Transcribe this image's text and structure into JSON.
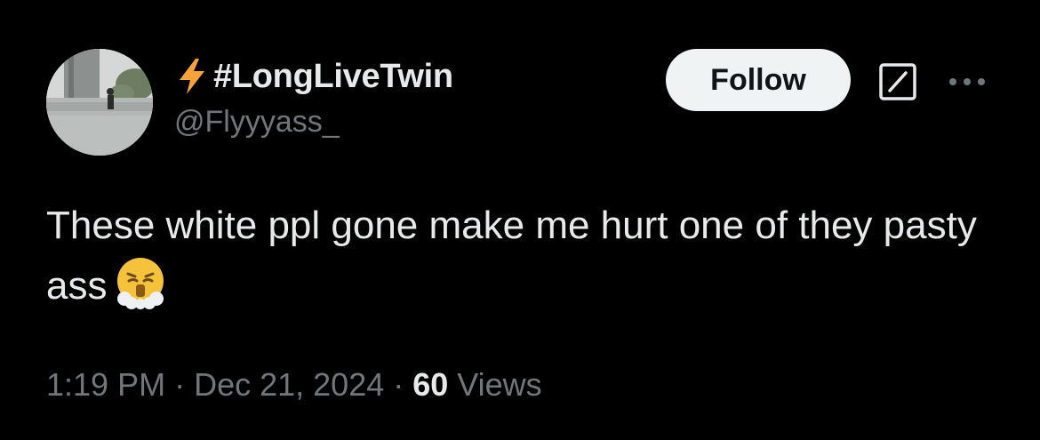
{
  "author": {
    "display_name": "#LongLiveTwin",
    "handle": "@Flyyyass_",
    "name_emoji_icon": "high-voltage-icon",
    "avatar_icon": "profile-photo-avatar"
  },
  "header": {
    "follow_label": "Follow",
    "grok_icon": "grok-icon",
    "more_icon": "more-options-icon"
  },
  "tweet": {
    "text": "These white ppl gone make me hurt one of they pasty ass",
    "emoji_icon": "face-with-steam-from-nose-icon"
  },
  "meta": {
    "time": "1:19 PM",
    "separator": " · ",
    "date": "Dec 21, 2024",
    "views_count": "60",
    "views_label": "Views"
  },
  "colors": {
    "background": "#000000",
    "primary_text": "#e7e9ea",
    "secondary_text": "#71767b",
    "follow_bg": "#eff3f4",
    "follow_text": "#0f1419",
    "bolt": "#f7a23a"
  }
}
